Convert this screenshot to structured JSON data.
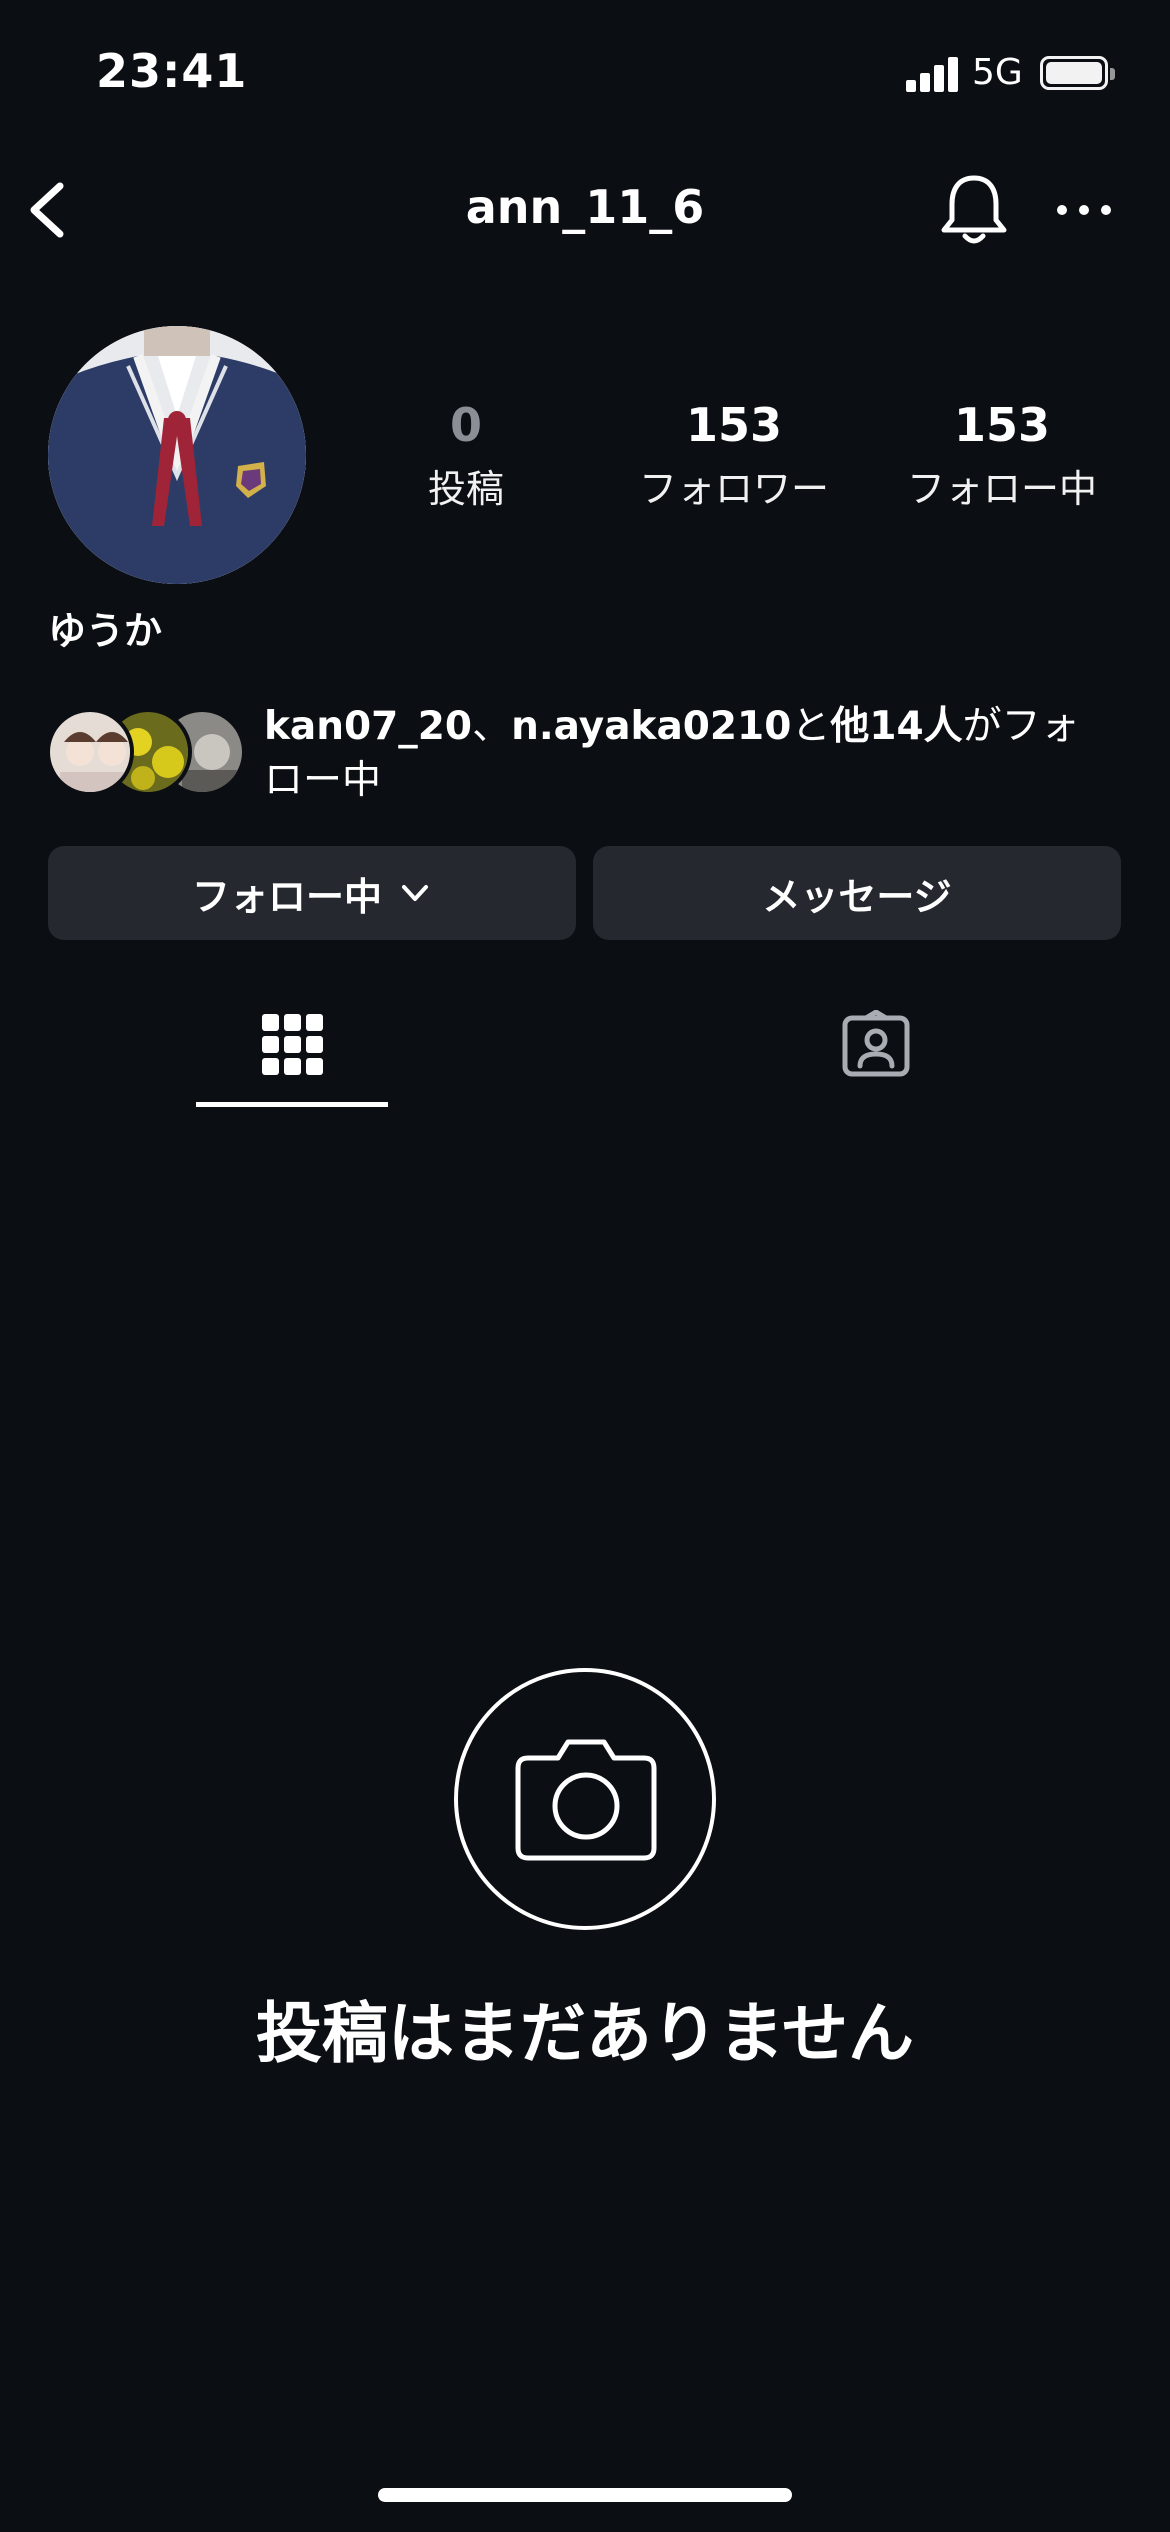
{
  "status_bar": {
    "time": "23:41",
    "network": "5G"
  },
  "header": {
    "username": "ann_11_6"
  },
  "profile": {
    "display_name": "ゆうか",
    "stats": [
      {
        "value": "0",
        "label": "投稿"
      },
      {
        "value": "153",
        "label": "フォロワー"
      },
      {
        "value": "153",
        "label": "フォロー中"
      }
    ]
  },
  "mutual": {
    "user1": "kan07_20",
    "sep": "、",
    "user2": "n.ayaka0210",
    "mid": "と",
    "others": "他14人",
    "tail": "がフォロー中"
  },
  "buttons": {
    "following": "フォロー中",
    "message": "メッセージ"
  },
  "tabs": [
    {
      "icon": "grid-icon",
      "active": true
    },
    {
      "icon": "tagged-icon",
      "active": false
    }
  ],
  "empty_state": {
    "text": "投稿はまだありません",
    "icon": "camera-icon"
  },
  "colors": {
    "background": "#0b0e13",
    "button": "#25282e",
    "muted": "#8b8e94"
  }
}
